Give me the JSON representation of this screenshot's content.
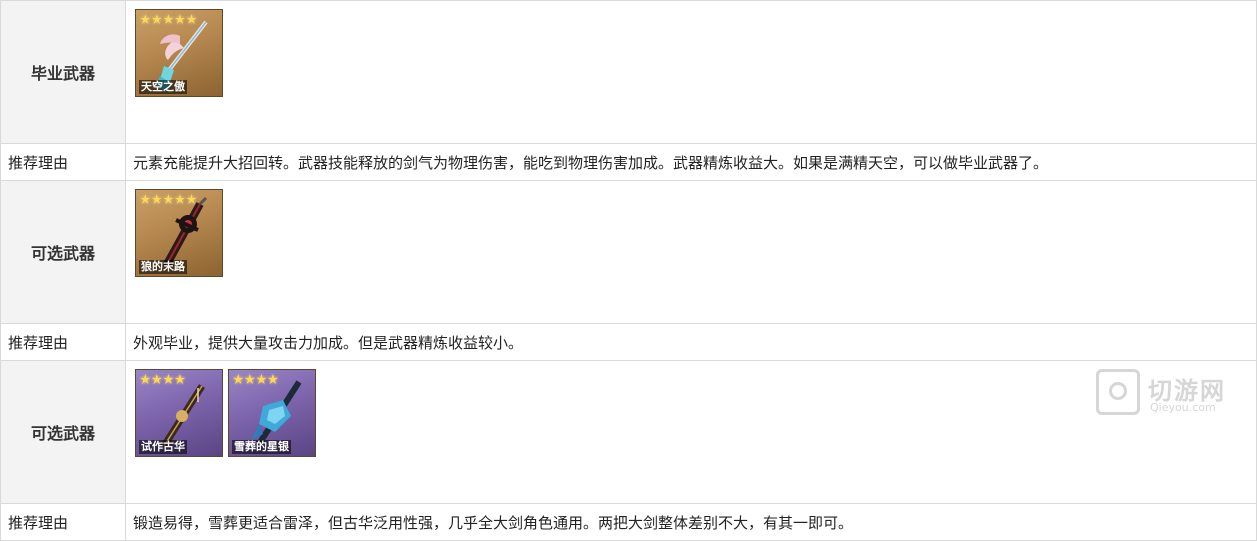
{
  "rows": [
    {
      "kind": "weapon",
      "label": "毕业武器",
      "weapons": [
        {
          "name": "天空之傲",
          "stars": "★★★★★",
          "rarity": 5,
          "icon": "greatsword-wing-icon"
        }
      ]
    },
    {
      "kind": "reason",
      "label": "推荐理由",
      "text": "元素充能提升大招回转。武器技能释放的剑气为物理伤害，能吃到物理伤害加成。武器精炼收益大。如果是满精天空，可以做毕业武器了。"
    },
    {
      "kind": "weapon",
      "label": "可选武器",
      "weapons": [
        {
          "name": "狼的末路",
          "stars": "★★★★★",
          "rarity": 5,
          "icon": "greatsword-dark-icon"
        }
      ]
    },
    {
      "kind": "reason",
      "label": "推荐理由",
      "text": "外观毕业，提供大量攻击力加成。但是武器精炼收益较小。"
    },
    {
      "kind": "weapon",
      "label": "可选武器",
      "weapons": [
        {
          "name": "试作古华",
          "stars": "★★★★",
          "rarity": 4,
          "icon": "greatsword-prototype-icon"
        },
        {
          "name": "雪葬的星银",
          "stars": "★★★★",
          "rarity": 4,
          "icon": "greatsword-ice-icon"
        }
      ]
    },
    {
      "kind": "reason",
      "label": "推荐理由",
      "text": "锻造易得，雪葬更适合雷泽，但古华泛用性强，几乎全大剑角色通用。两把大剑整体差别不大，有其一即可。"
    }
  ],
  "watermark": {
    "cn": "切游网",
    "en": "Qieyou.com"
  }
}
